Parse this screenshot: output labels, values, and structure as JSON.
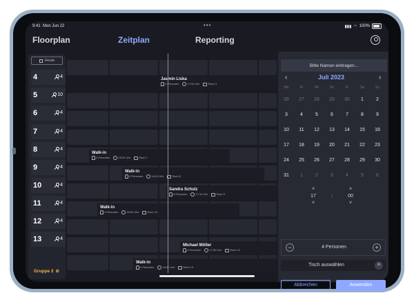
{
  "status": {
    "time": "9:41",
    "date": "Mon Jun 22",
    "dots": "•••",
    "battery": "100%"
  },
  "nav": {
    "floorplan": "Floorplan",
    "zeitplan": "Zeitplan",
    "reporting": "Reporting"
  },
  "sidebar": {
    "today_label": "Heute",
    "tables": [
      {
        "number": "4",
        "capacity": "4"
      },
      {
        "number": "5",
        "capacity": "10"
      },
      {
        "number": "6",
        "capacity": "4"
      },
      {
        "number": "7",
        "capacity": "4"
      },
      {
        "number": "8",
        "capacity": "4"
      },
      {
        "number": "9",
        "capacity": "4"
      },
      {
        "number": "10",
        "capacity": "4"
      },
      {
        "number": "11",
        "capacity": "4"
      },
      {
        "number": "12",
        "capacity": "4"
      },
      {
        "number": "13",
        "capacity": "4"
      }
    ],
    "group_label": "Gruppe 2"
  },
  "reservations": [
    {
      "name": "Jasmin Liska",
      "persons": "3 Personen",
      "time": "17:00 Uhr",
      "table": "Tisch 4"
    },
    {
      "name": "Walk-in",
      "persons": "4 Personen",
      "time": "15:30 Uhr",
      "table": "Tisch 7"
    },
    {
      "name": "Walk-in",
      "persons": "4 Personen",
      "time": "16:20 Uhr",
      "table": "Tisch 8"
    },
    {
      "name": "Sandra Schulz",
      "persons": "4 Personen",
      "time": "17:10 Uhr",
      "table": "Tisch 9"
    },
    {
      "name": "Walk-in",
      "persons": "4 Personen",
      "time": "15:50 Uhr",
      "table": "Tisch 10"
    },
    {
      "name": "Michael Möller",
      "persons": "4 Personen",
      "time": "17:30 Uhr",
      "table": "Tisch 12"
    },
    {
      "name": "Walk-in",
      "persons": "4 Personen",
      "time": "16:30 Uhr",
      "table": "Tisch 13"
    }
  ],
  "form": {
    "name_placeholder": "Bitte Namen eintragen...",
    "month": "Juli 2023",
    "weekdays": [
      "Mo",
      "Di",
      "Mi",
      "Do",
      "Fr",
      "Sa",
      "So"
    ],
    "days": [
      [
        "26",
        "27",
        "28",
        "29",
        "30",
        "1",
        "2"
      ],
      [
        "3",
        "4",
        "5",
        "6",
        "7",
        "8",
        "9"
      ],
      [
        "10",
        "11",
        "12",
        "13",
        "14",
        "15",
        "16"
      ],
      [
        "17",
        "18",
        "19",
        "20",
        "21",
        "22",
        "23"
      ],
      [
        "24",
        "25",
        "26",
        "27",
        "28",
        "29",
        "30"
      ],
      [
        "31",
        "1",
        "2",
        "3",
        "4",
        "5",
        "6"
      ]
    ],
    "hour": "17",
    "separator": ":",
    "minute": "00",
    "persons": "4 Personen",
    "table_select": "Tisch auswählen",
    "cancel": "Abbrechen",
    "apply": "Anwenden"
  }
}
